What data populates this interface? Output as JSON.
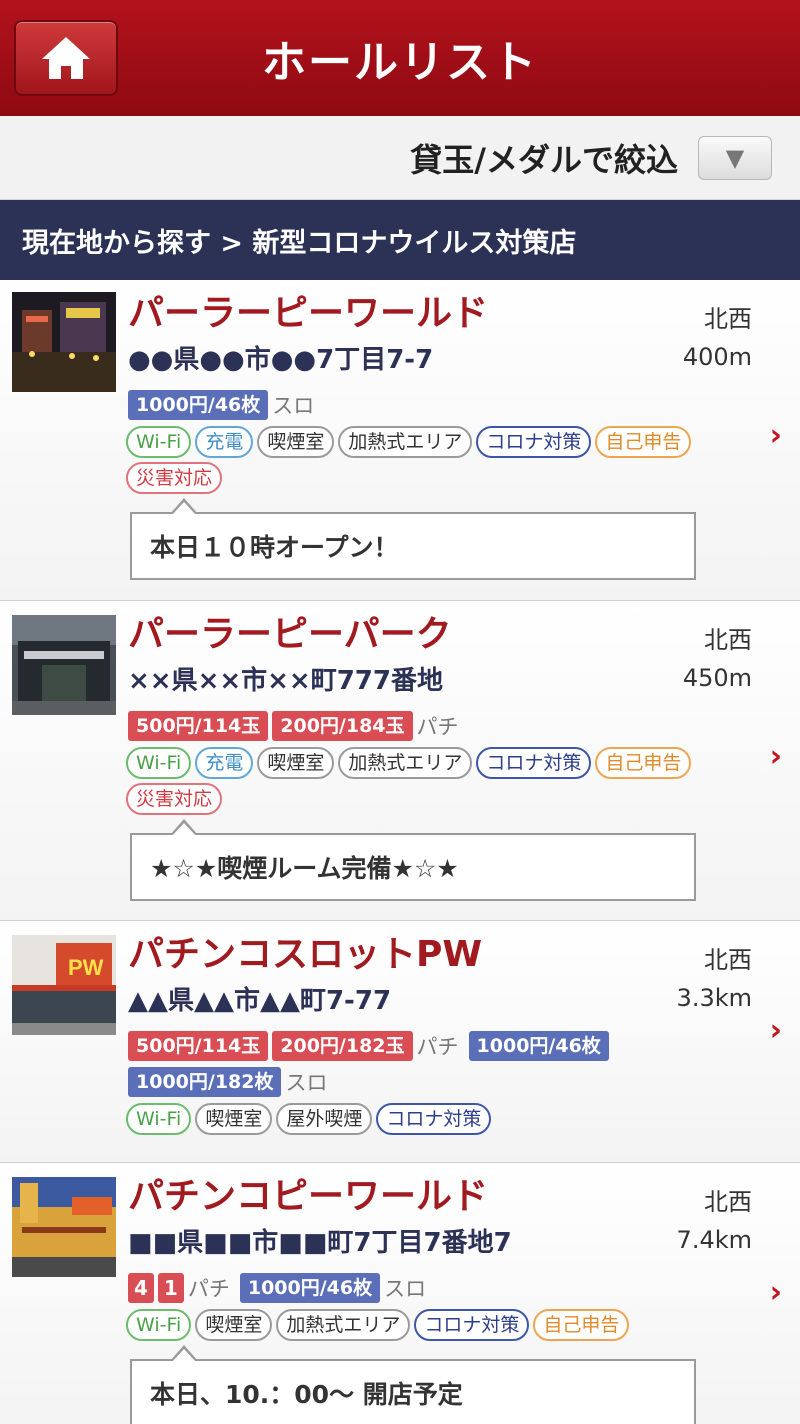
{
  "header": {
    "title": "ホールリスト",
    "home_icon": "home-icon"
  },
  "filter": {
    "label": "貸玉/メダルで絞込",
    "toggle_glyph": "▼"
  },
  "breadcrumb": {
    "text": "現在地から探す > 新型コロナウイルス対策店"
  },
  "halls": [
    {
      "name": "パーラーピーワールド",
      "address": "●●県●●市●●7丁目7-7",
      "direction": "北西",
      "distance": "400m",
      "rates": [
        {
          "label": "1000円/46枚",
          "color": "blue"
        }
      ],
      "rate_category": "スロ",
      "facilities": [
        "Wi-Fi",
        "充電",
        "喫煙室",
        "加熱式エリア",
        "コロナ対策",
        "自己申告",
        "災害対応"
      ],
      "message": "本日１０時オープン！"
    },
    {
      "name": "パーラーピーパーク",
      "address": "××県××市××町777番地",
      "direction": "北西",
      "distance": "450m",
      "rates": [
        {
          "label": "500円/114玉",
          "color": "red"
        },
        {
          "label": "200円/184玉",
          "color": "red"
        }
      ],
      "rate_category": "パチ",
      "facilities": [
        "Wi-Fi",
        "充電",
        "喫煙室",
        "加熱式エリア",
        "コロナ対策",
        "自己申告",
        "災害対応"
      ],
      "message": "★☆★喫煙ルーム完備★☆★"
    },
    {
      "name": "パチンコスロットPW",
      "address": "▲▲県▲▲市▲▲町7-77",
      "direction": "北西",
      "distance": "3.3km",
      "rates": [
        {
          "label": "500円/114玉",
          "color": "red"
        },
        {
          "label": "200円/182玉",
          "color": "red"
        }
      ],
      "rate_category": "パチ",
      "rates2": [
        {
          "label": "1000円/46枚",
          "color": "blue"
        },
        {
          "label": "1000円/182枚",
          "color": "blue"
        }
      ],
      "rate_category2": "スロ",
      "facilities": [
        "Wi-Fi",
        "喫煙室",
        "屋外喫煙",
        "コロナ対策"
      ],
      "thumb_sign": "PW"
    },
    {
      "name": "パチンコピーワールド",
      "address": "■■県■■市■■町7丁目7番地7",
      "direction": "北西",
      "distance": "7.4km",
      "num_badges": [
        "4",
        "1"
      ],
      "rate_category": "パチ",
      "rates2": [
        {
          "label": "1000円/46枚",
          "color": "blue"
        }
      ],
      "rate_category2": "スロ",
      "facilities": [
        "Wi-Fi",
        "喫煙室",
        "加熱式エリア",
        "コロナ対策",
        "自己申告"
      ],
      "message": "本日、10.：00～ 開店予定"
    }
  ]
}
